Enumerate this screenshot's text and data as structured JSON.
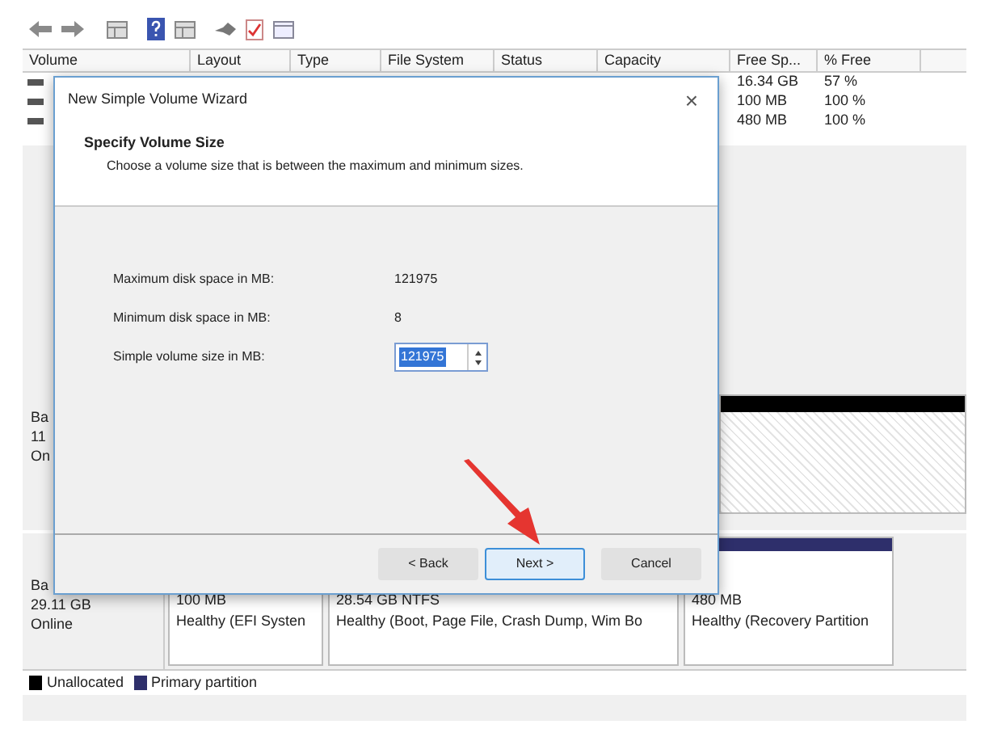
{
  "volume_table": {
    "columns": [
      "Volume",
      "Layout",
      "Type",
      "File System",
      "Status",
      "Capacity",
      "Free Sp...",
      "% Free"
    ],
    "rows": [
      {
        "free_space": "16.34 GB",
        "percent_free": "57 %"
      },
      {
        "free_space": "100 MB",
        "percent_free": "100 %"
      },
      {
        "free_space": "480 MB",
        "percent_free": "100 %"
      }
    ]
  },
  "disks": [
    {
      "label": "Ba",
      "size": "11",
      "status": "On",
      "partitions": [
        {
          "kind": "unallocated"
        }
      ]
    },
    {
      "label": "Ba",
      "size": "29.11 GB",
      "status": "Online",
      "partitions": [
        {
          "kind": "primary",
          "size": "100 MB",
          "health": "Healthy (EFI Systen"
        },
        {
          "kind": "primary",
          "size": "28.54 GB NTFS",
          "health": "Healthy (Boot, Page File, Crash Dump, Wim Bo"
        },
        {
          "kind": "primary",
          "size": "480 MB",
          "health": "Healthy (Recovery Partition"
        }
      ]
    }
  ],
  "legend": [
    {
      "label": "Unallocated",
      "color": "#000000"
    },
    {
      "label": "Primary partition",
      "color": "#2e2f6b"
    }
  ],
  "dialog": {
    "title": "New Simple Volume Wizard",
    "close": "×",
    "heading": "Specify Volume Size",
    "subtitle": "Choose a volume size that is between the maximum and minimum sizes.",
    "fields": [
      {
        "kind": "value",
        "label": "Maximum disk space in MB:",
        "value": "121975"
      },
      {
        "kind": "value",
        "label": "Minimum disk space in MB:",
        "value": "8"
      },
      {
        "kind": "spin",
        "label": "Simple volume size in MB:",
        "value": "121975"
      }
    ],
    "buttons": [
      {
        "label": "< Back",
        "selected": false
      },
      {
        "label": "Next >",
        "selected": true
      },
      {
        "label": "Cancel",
        "selected": false
      }
    ]
  }
}
